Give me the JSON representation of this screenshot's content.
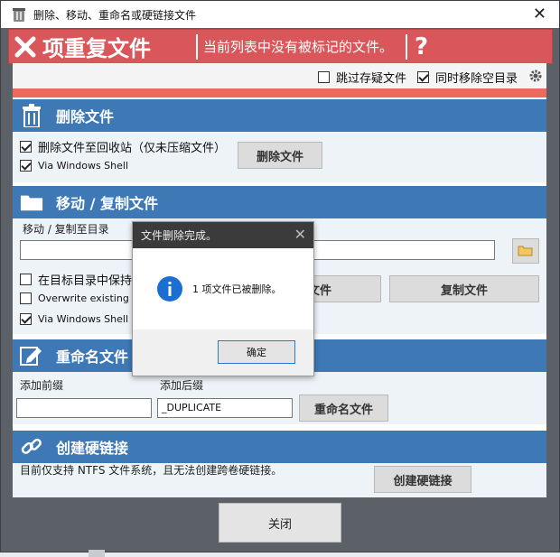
{
  "window": {
    "title": "删除、移动、重命名或硬链接文件",
    "close_glyph": "✕"
  },
  "banner": {
    "heading": "项重复文件",
    "message": "当前列表中没有被标记的文件。",
    "help": "?"
  },
  "options": {
    "skip_stored": "跳过存疑文件",
    "remove_empty": "同时移除空目录",
    "skip_stored_checked": false,
    "remove_empty_checked": true
  },
  "delete_section": {
    "label": "删除文件",
    "to_recycle": "删除文件至回收站（仅未压缩文件）",
    "via_shell": "Via Windows Shell",
    "to_recycle_checked": true,
    "via_shell_checked": true,
    "button": "删除文件"
  },
  "move_section": {
    "label": "移动 / 复制文件",
    "dest_label": "移动 / 复制至目录",
    "dest_value": "",
    "keep_struct": "在目标目录中保持",
    "overwrite": "Overwrite existing fil",
    "via_shell": "Via Windows Shell",
    "keep_struct_checked": false,
    "overwrite_checked": false,
    "via_shell_checked": true,
    "move_button_partial": "文件",
    "copy_button": "复制文件"
  },
  "rename_section": {
    "label": "重命名文件",
    "prefix_label": "添加前缀",
    "suffix_label": "添加后缀",
    "prefix_value": "",
    "suffix_value": "_DUPLICATE",
    "button": "重命名文件"
  },
  "hardlink_section": {
    "label": "创建硬链接",
    "note": "目前仅支持 NTFS 文件系统，且无法创建跨卷硬链接。",
    "button": "创建硬链接"
  },
  "footer": {
    "close": "关闭"
  },
  "modal": {
    "title": "文件删除完成。",
    "close_glyph": "✕",
    "message": "1 项文件已被删除。",
    "ok": "确定"
  },
  "colors": {
    "banner": "#d9575a",
    "section_header": "#3e79b6",
    "section_body": "#eef3f8",
    "accent_bar": "#e96b5c",
    "frame": "#5c6168"
  }
}
